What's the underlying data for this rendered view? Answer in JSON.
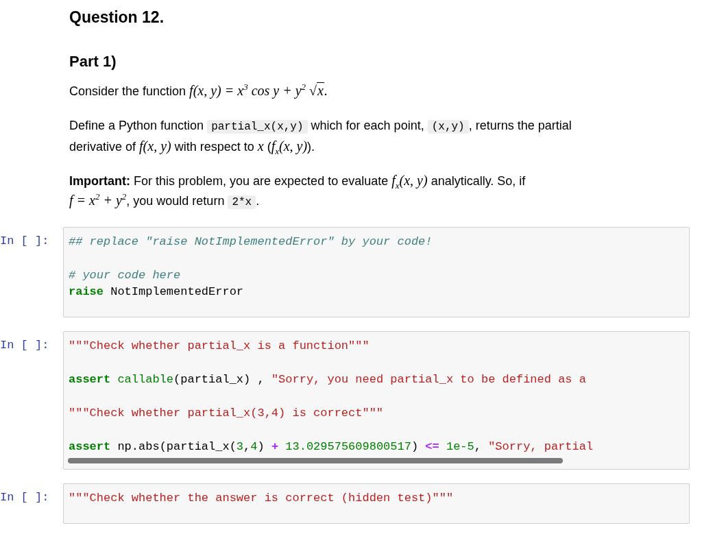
{
  "title": "Question 12.",
  "part": "Part 1)",
  "paragraphs": [
    {
      "lines": [
        [
          {
            "kind": "text",
            "text": "Consider the function "
          },
          {
            "kind": "math",
            "text": "f(x, y) = x$^{3}$ cos y + y$^{2}$ "
          },
          {
            "kind": "sqrt",
            "radical": "√",
            "text": "x"
          },
          {
            "kind": "math",
            "text": "."
          }
        ]
      ]
    },
    {
      "lines": [
        [
          {
            "kind": "text",
            "text": "Define a Python function "
          },
          {
            "kind": "code",
            "text": "partial_x(x,y)"
          },
          {
            "kind": "text",
            "text": " which for each point, "
          },
          {
            "kind": "code",
            "text": "(x,y)"
          },
          {
            "kind": "text",
            "text": ", returns the partial"
          }
        ],
        [
          {
            "kind": "text",
            "text": "derivative of "
          },
          {
            "kind": "math",
            "text": "f(x, y)"
          },
          {
            "kind": "text",
            "text": " with respect to "
          },
          {
            "kind": "math",
            "text": "x"
          },
          {
            "kind": "text",
            "text": " ("
          },
          {
            "kind": "math",
            "text": "f$_{x}$(x, y)"
          },
          {
            "kind": "text",
            "text": ")."
          }
        ]
      ]
    },
    {
      "lines": [
        [
          {
            "kind": "bold",
            "text": "Important:"
          },
          {
            "kind": "text",
            "text": " For this problem, you are expected to evaluate "
          },
          {
            "kind": "math",
            "text": "f$_{x}$(x, y)"
          },
          {
            "kind": "text",
            "text": " analytically. So, if"
          }
        ],
        [
          {
            "kind": "math",
            "text": "f = x$^{2}$ + y$^{2}$"
          },
          {
            "kind": "text",
            "text": ", you would return "
          },
          {
            "kind": "code",
            "text": "2*x"
          },
          {
            "kind": "text",
            "text": "."
          }
        ]
      ]
    }
  ],
  "cells": [
    {
      "prompt": "In [ ]:",
      "scrollbar": false,
      "blocks": [
        [
          [
            {
              "kind": "comment",
              "t": "## replace \"raise NotImplementedError\" by your code!"
            }
          ]
        ],
        [
          [
            {
              "kind": "comment",
              "t": "# your code here"
            }
          ],
          [
            {
              "kind": "keyword",
              "t": "raise"
            },
            {
              "kind": "plain",
              "t": " NotImplementedError"
            }
          ]
        ]
      ]
    },
    {
      "prompt": "In [ ]:",
      "scrollbar": true,
      "blocks": [
        [
          [
            {
              "kind": "string",
              "t": "\"\"\"Check whether partial_x is a function\"\"\""
            }
          ]
        ],
        [
          [
            {
              "kind": "keyword",
              "t": "assert"
            },
            {
              "kind": "builtin",
              "t": " callable"
            },
            {
              "kind": "plain",
              "t": "(partial_x) , "
            },
            {
              "kind": "string",
              "t": "\"Sorry, you need partial_x to be defined as a"
            }
          ]
        ],
        [
          [
            {
              "kind": "string",
              "t": "\"\"\"Check whether partial_x(3,4) is correct\"\"\""
            }
          ]
        ],
        [
          [
            {
              "kind": "keyword",
              "t": "assert"
            },
            {
              "kind": "plain",
              "t": " np.abs(partial_x("
            },
            {
              "kind": "number",
              "t": "3"
            },
            {
              "kind": "plain",
              "t": ","
            },
            {
              "kind": "number",
              "t": "4"
            },
            {
              "kind": "plain",
              "t": ") "
            },
            {
              "kind": "operator",
              "t": "+"
            },
            {
              "kind": "number",
              "t": " 13.029575609800517"
            },
            {
              "kind": "plain",
              "t": ") "
            },
            {
              "kind": "operator",
              "t": "<="
            },
            {
              "kind": "number",
              "t": " 1e-5"
            },
            {
              "kind": "plain",
              "t": ", "
            },
            {
              "kind": "string",
              "t": "\"Sorry, partial"
            }
          ]
        ]
      ]
    },
    {
      "prompt": "In [ ]:",
      "scrollbar": false,
      "blocks": [
        [
          [
            {
              "kind": "string",
              "t": "\"\"\"Check whether the answer is correct (hidden test)\"\"\""
            }
          ]
        ]
      ]
    }
  ]
}
